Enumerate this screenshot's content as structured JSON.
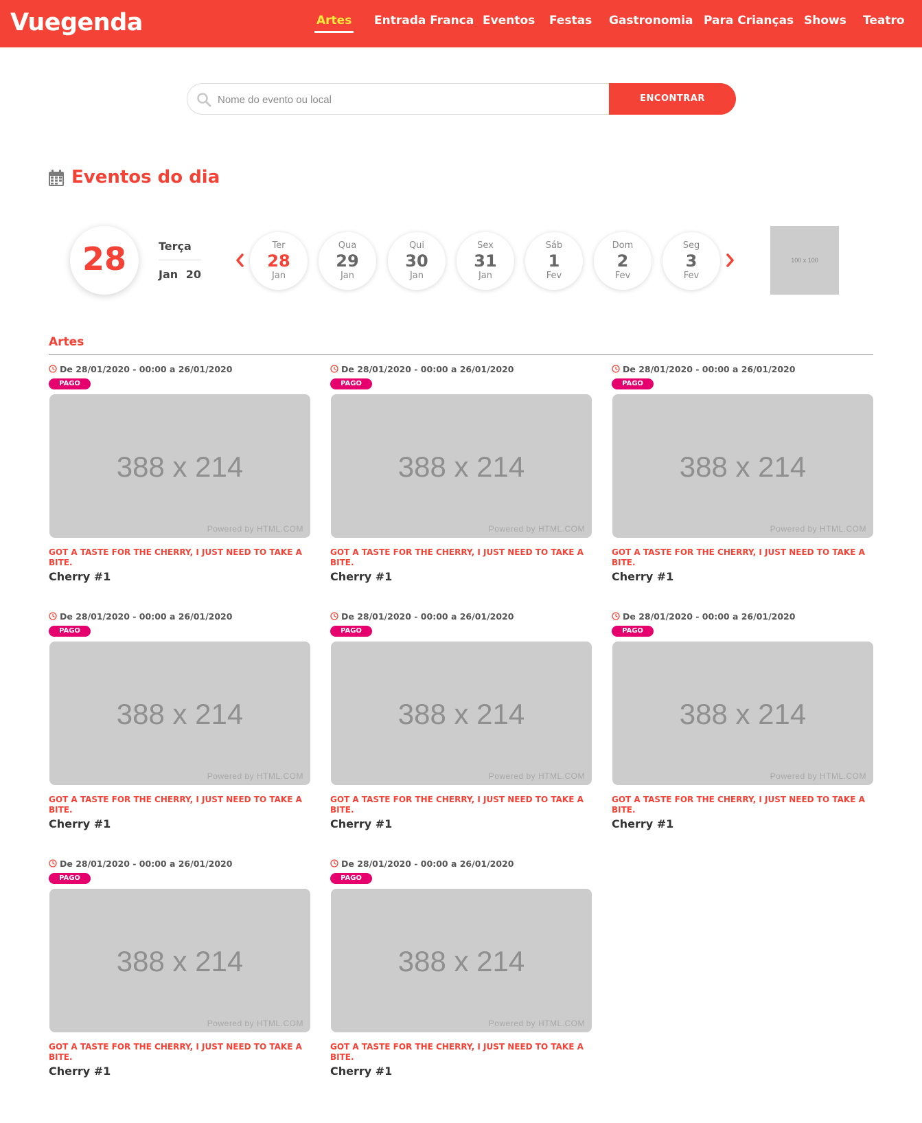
{
  "brand": "Vuegenda",
  "nav": [
    {
      "label": "Artes",
      "active": true
    },
    {
      "label": "Entrada Franca",
      "active": false
    },
    {
      "label": "Eventos",
      "active": false
    },
    {
      "label": "Festas",
      "active": false
    },
    {
      "label": "Gastronomia",
      "active": false
    },
    {
      "label": "Para Crianças",
      "active": false
    },
    {
      "label": "Shows",
      "active": false
    },
    {
      "label": "Teatro",
      "active": false
    }
  ],
  "search": {
    "placeholder": "Nome do evento ou local",
    "value": "",
    "button_label": "ENCONTRAR"
  },
  "section": {
    "title": "Eventos do dia"
  },
  "today": {
    "day": "28",
    "weekday": "Terça",
    "month_year": "Jan 20"
  },
  "days": [
    {
      "weekday": "Ter",
      "day": "28",
      "month": "Jan",
      "selected": true
    },
    {
      "weekday": "Qua",
      "day": "29",
      "month": "Jan",
      "selected": false
    },
    {
      "weekday": "Qui",
      "day": "30",
      "month": "Jan",
      "selected": false
    },
    {
      "weekday": "Sex",
      "day": "31",
      "month": "Jan",
      "selected": false
    },
    {
      "weekday": "Sáb",
      "day": "1",
      "month": "Fev",
      "selected": false
    },
    {
      "weekday": "Dom",
      "day": "2",
      "month": "Fev",
      "selected": false
    },
    {
      "weekday": "Seg",
      "day": "3",
      "month": "Fev",
      "selected": false
    }
  ],
  "ad": {
    "label": "100 x 100"
  },
  "category": {
    "title": "Artes",
    "events": [
      {
        "date": "De 28/01/2020 - 00:00 a 26/01/2020",
        "badge": "PAGO",
        "image_label": "388 x 214",
        "image_credit": "Powered by HTML.COM",
        "subtitle": "GOT A TASTE FOR THE CHERRY, I JUST NEED TO TAKE A BITE.",
        "title": "Cherry #1"
      },
      {
        "date": "De 28/01/2020 - 00:00 a 26/01/2020",
        "badge": "PAGO",
        "image_label": "388 x 214",
        "image_credit": "Powered by HTML.COM",
        "subtitle": "GOT A TASTE FOR THE CHERRY, I JUST NEED TO TAKE A BITE.",
        "title": "Cherry #1"
      },
      {
        "date": "De 28/01/2020 - 00:00 a 26/01/2020",
        "badge": "PAGO",
        "image_label": "388 x 214",
        "image_credit": "Powered by HTML.COM",
        "subtitle": "GOT A TASTE FOR THE CHERRY, I JUST NEED TO TAKE A BITE.",
        "title": "Cherry #1"
      },
      {
        "date": "De 28/01/2020 - 00:00 a 26/01/2020",
        "badge": "PAGO",
        "image_label": "388 x 214",
        "image_credit": "Powered by HTML.COM",
        "subtitle": "GOT A TASTE FOR THE CHERRY, I JUST NEED TO TAKE A BITE.",
        "title": "Cherry #1"
      },
      {
        "date": "De 28/01/2020 - 00:00 a 26/01/2020",
        "badge": "PAGO",
        "image_label": "388 x 214",
        "image_credit": "Powered by HTML.COM",
        "subtitle": "GOT A TASTE FOR THE CHERRY, I JUST NEED TO TAKE A BITE.",
        "title": "Cherry #1"
      },
      {
        "date": "De 28/01/2020 - 00:00 a 26/01/2020",
        "badge": "PAGO",
        "image_label": "388 x 214",
        "image_credit": "Powered by HTML.COM",
        "subtitle": "GOT A TASTE FOR THE CHERRY, I JUST NEED TO TAKE A BITE.",
        "title": "Cherry #1"
      },
      {
        "date": "De 28/01/2020 - 00:00 a 26/01/2020",
        "badge": "PAGO",
        "image_label": "388 x 214",
        "image_credit": "Powered by HTML.COM",
        "subtitle": "GOT A TASTE FOR THE CHERRY, I JUST NEED TO TAKE A BITE.",
        "title": "Cherry #1"
      },
      {
        "date": "De 28/01/2020 - 00:00 a 26/01/2020",
        "badge": "PAGO",
        "image_label": "388 x 214",
        "image_credit": "Powered by HTML.COM",
        "subtitle": "GOT A TASTE FOR THE CHERRY, I JUST NEED TO TAKE A BITE.",
        "title": "Cherry #1"
      }
    ]
  },
  "colors": {
    "brand": "#f44336",
    "nav_active": "#ffeb3b",
    "badge": "#e6006e",
    "placeholder_image": "#cccccc"
  },
  "icons": {
    "search": "search-icon",
    "calendar": "calendar-icon",
    "clock": "clock-icon",
    "prev": "chevron-left-icon",
    "next": "chevron-right-icon"
  }
}
